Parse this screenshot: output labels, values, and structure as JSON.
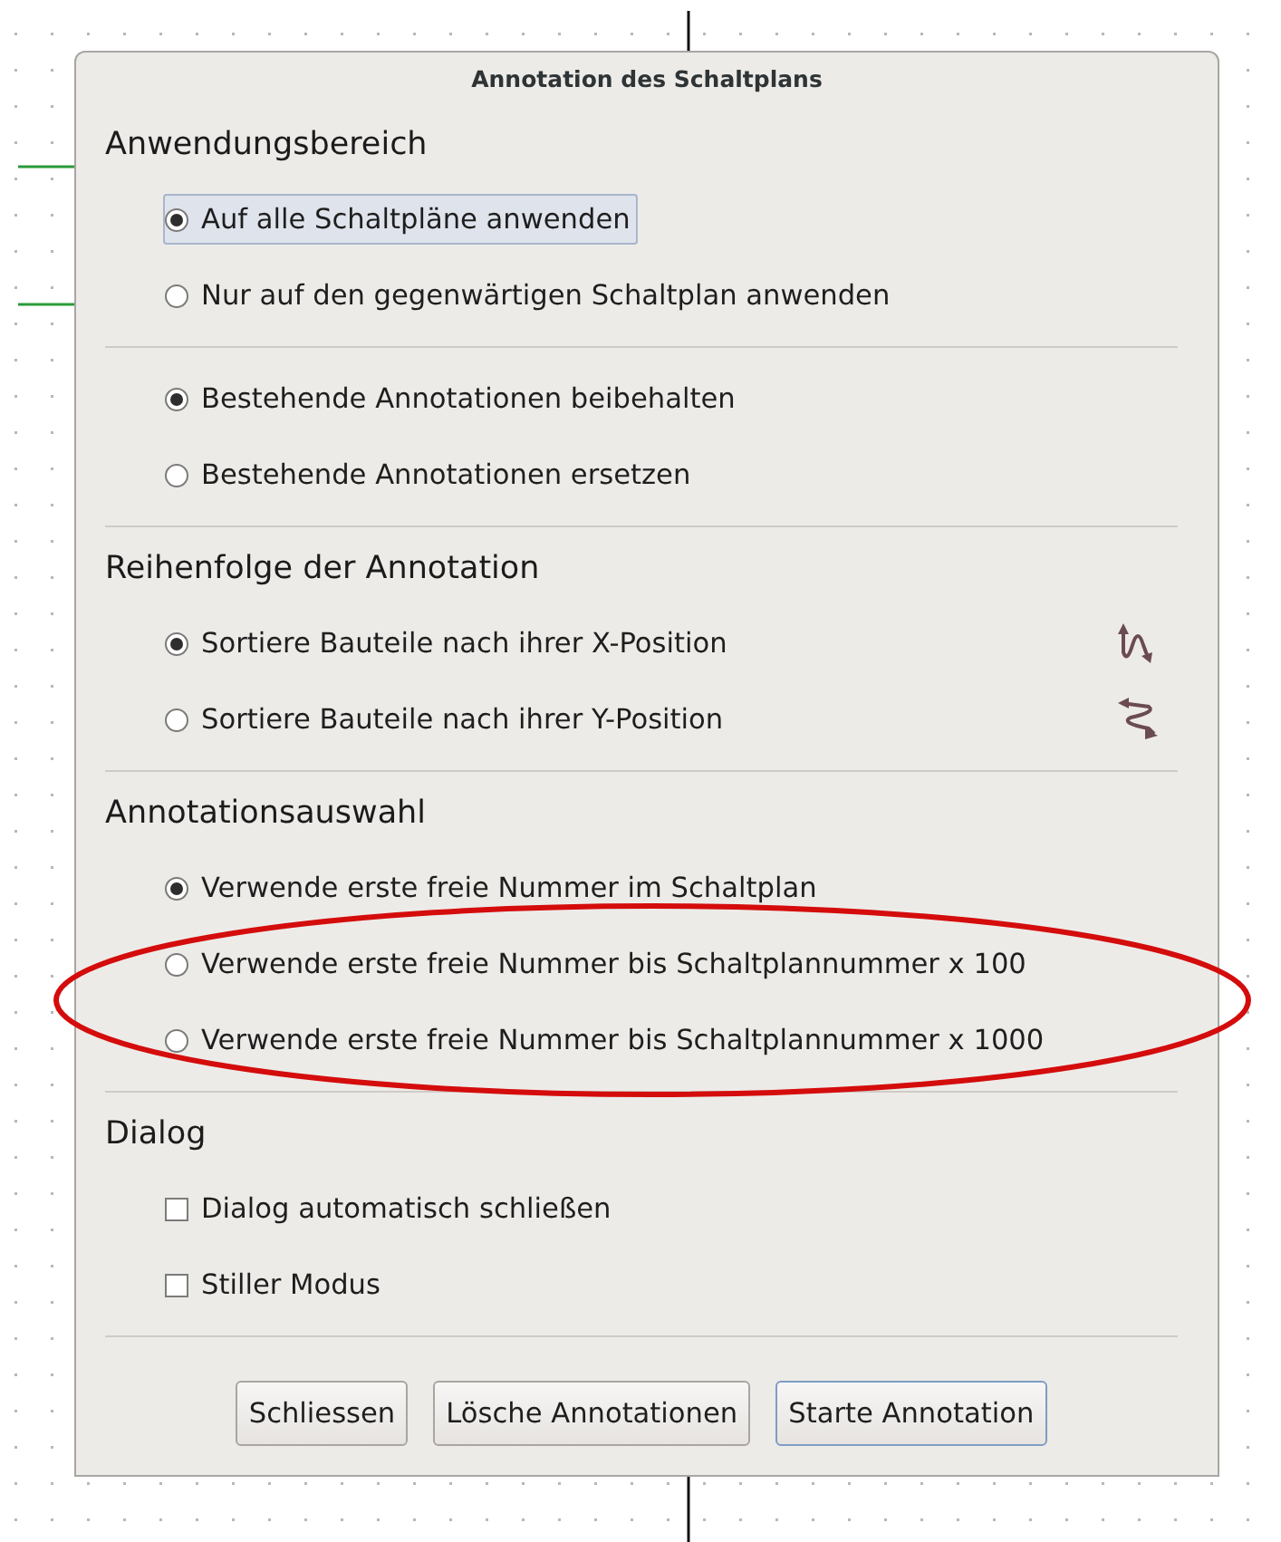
{
  "window": {
    "title": "Annotation des Schaltplans"
  },
  "sections": [
    {
      "heading": "Anwendungsbereich",
      "kind": "plain",
      "groups": [
        [
          {
            "kind": "radio",
            "label": "Auf alle Schaltpläne anwenden",
            "selected": true,
            "focused": true
          },
          {
            "kind": "radio",
            "label": "Nur auf den gegenwärtigen Schaltplan anwenden",
            "selected": false,
            "focused": false
          }
        ],
        [
          {
            "kind": "radio",
            "label": "Bestehende Annotationen beibehalten",
            "selected": true,
            "focused": false
          },
          {
            "kind": "radio",
            "label": "Bestehende Annotationen ersetzen",
            "selected": false,
            "focused": false
          }
        ]
      ]
    },
    {
      "heading": "Reihenfolge der Annotation",
      "kind": "ordering",
      "groups": [
        [
          {
            "kind": "radio",
            "label": "Sortiere Bauteile nach ihrer X-Position",
            "selected": true,
            "focused": false
          },
          {
            "kind": "radio",
            "label": "Sortiere Bauteile nach ihrer Y-Position",
            "selected": false,
            "focused": false
          }
        ]
      ]
    },
    {
      "heading": "Annotationsauswahl",
      "kind": "plain",
      "groups": [
        [
          {
            "kind": "radio",
            "label": "Verwende erste freie Nummer im Schaltplan",
            "selected": true,
            "focused": false
          },
          {
            "kind": "radio",
            "label": "Verwende erste freie Nummer bis Schaltplannummer x 100",
            "selected": false,
            "focused": false
          },
          {
            "kind": "radio",
            "label": "Verwende erste freie Nummer bis Schaltplannummer x 1000",
            "selected": false,
            "focused": false
          }
        ]
      ]
    },
    {
      "heading": "Dialog",
      "kind": "plain",
      "groups": [
        [
          {
            "kind": "check",
            "label": "Dialog automatisch schließen",
            "checked": false,
            "focused": false
          },
          {
            "kind": "check",
            "label": "Stiller Modus",
            "checked": false,
            "focused": false
          }
        ]
      ]
    }
  ],
  "buttons": [
    {
      "label": "Schliessen",
      "default": false
    },
    {
      "label": "Lösche Annotationen",
      "default": false
    },
    {
      "label": "Starte Annotation",
      "default": true
    }
  ]
}
